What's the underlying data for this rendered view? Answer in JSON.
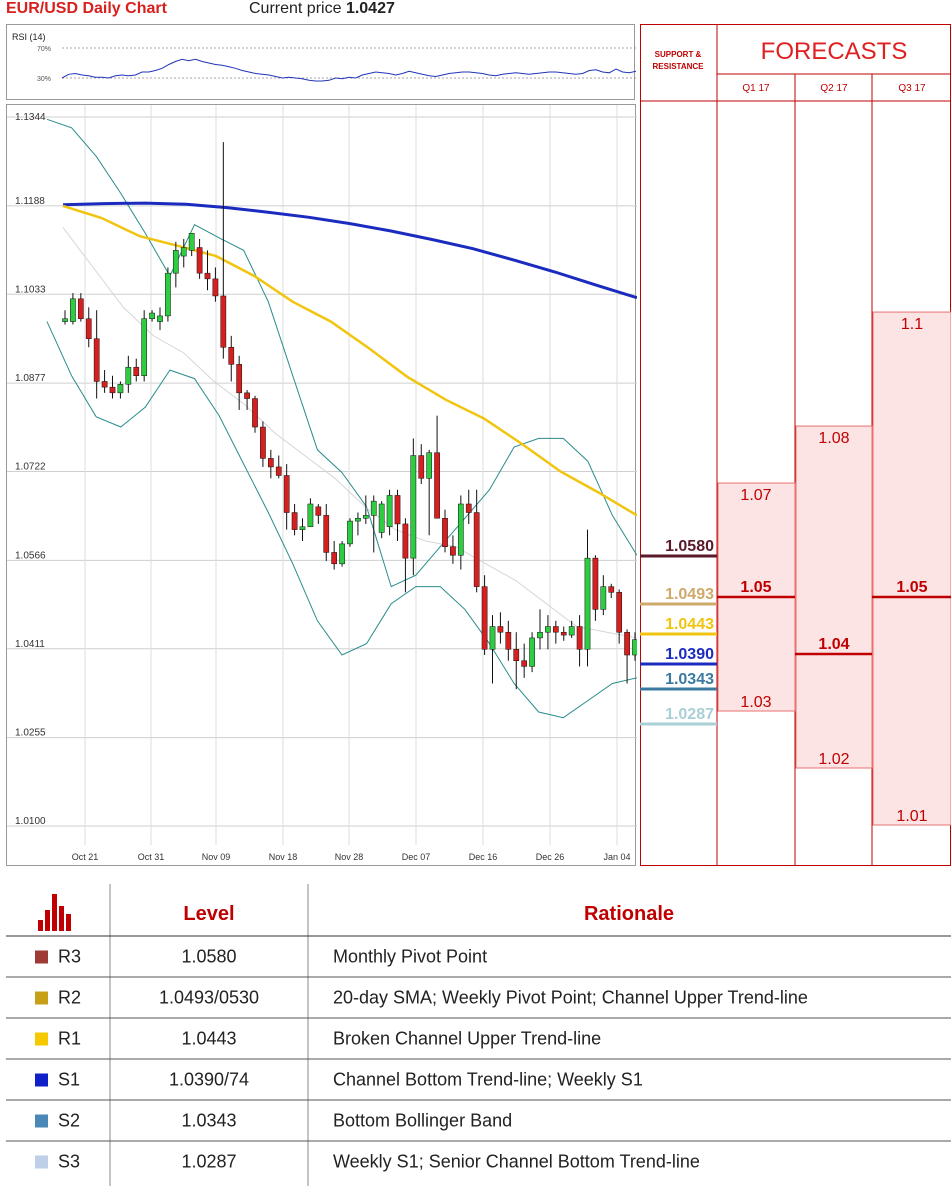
{
  "header": {
    "title": "EUR/USD Daily Chart",
    "price_label": "Current price",
    "price_value": "1.0427"
  },
  "rsi": {
    "label": "RSI (14)",
    "levels": [
      "70%",
      "30%"
    ],
    "values": [
      30,
      35,
      36,
      34,
      33,
      31,
      31,
      30,
      33,
      34,
      33,
      34,
      38,
      38,
      40,
      43,
      48,
      52,
      55,
      53,
      55,
      52,
      50,
      48,
      47,
      45,
      43,
      40,
      38,
      36,
      35,
      34,
      32,
      30,
      31,
      30,
      29,
      27,
      26,
      26,
      27,
      30,
      29,
      31,
      30,
      34,
      36,
      38,
      37,
      36,
      34,
      36,
      39,
      37,
      35,
      33,
      32,
      34,
      36,
      37,
      38,
      38,
      37,
      36,
      34,
      33,
      35,
      36,
      37,
      36,
      35,
      36,
      37,
      38,
      38,
      37,
      36,
      35,
      36,
      40,
      41,
      38,
      37,
      42,
      38,
      37,
      39
    ]
  },
  "chart_data": {
    "type": "candlestick",
    "ylim": [
      1.01,
      1.1344
    ],
    "y_ticks": [
      "1.1344",
      "1.1188",
      "1.1033",
      "1.0877",
      "1.0722",
      "1.0566",
      "1.0411",
      "1.0255",
      "1.0100"
    ],
    "x_ticks": [
      "Oct 21",
      "Oct 31",
      "Nov 09",
      "Nov 18",
      "Nov 28",
      "Dec 07",
      "Dec 16",
      "Dec 26",
      "Jan 04"
    ],
    "candles": [
      [
        1.0985,
        1.1005,
        1.098,
        1.099
      ],
      [
        1.0985,
        1.1035,
        1.098,
        1.1025
      ],
      [
        1.1025,
        1.1035,
        1.0985,
        1.099
      ],
      [
        1.099,
        1.101,
        1.094,
        1.0955
      ],
      [
        1.0955,
        1.1005,
        1.085,
        1.088
      ],
      [
        1.088,
        1.09,
        1.086,
        1.087
      ],
      [
        1.087,
        1.089,
        1.085,
        1.086
      ],
      [
        1.086,
        1.088,
        1.085,
        1.0875
      ],
      [
        1.0875,
        1.0925,
        1.086,
        1.0905
      ],
      [
        1.0905,
        1.092,
        1.088,
        1.089
      ],
      [
        1.089,
        1.1005,
        1.088,
        1.099
      ],
      [
        1.099,
        1.1005,
        1.0985,
        1.1
      ],
      [
        1.0985,
        1.101,
        1.097,
        1.0995
      ],
      [
        1.0995,
        1.108,
        1.0985,
        1.107
      ],
      [
        1.107,
        1.1125,
        1.1045,
        1.111
      ],
      [
        1.11,
        1.113,
        1.108,
        1.1115
      ],
      [
        1.111,
        1.114,
        1.11,
        1.114
      ],
      [
        1.1115,
        1.113,
        1.106,
        1.107
      ],
      [
        1.107,
        1.111,
        1.104,
        1.106
      ],
      [
        1.106,
        1.108,
        1.102,
        1.103
      ],
      [
        1.103,
        1.13,
        1.092,
        1.094
      ],
      [
        1.094,
        1.096,
        1.088,
        1.091
      ],
      [
        1.091,
        1.0925,
        1.083,
        1.086
      ],
      [
        1.086,
        1.0865,
        1.083,
        1.085
      ],
      [
        1.085,
        1.0855,
        1.079,
        1.08
      ],
      [
        1.08,
        1.081,
        1.073,
        1.0745
      ],
      [
        1.0745,
        1.076,
        1.071,
        1.073
      ],
      [
        1.073,
        1.075,
        1.071,
        1.0715
      ],
      [
        1.0715,
        1.0735,
        1.062,
        1.065
      ],
      [
        1.065,
        1.0665,
        1.061,
        1.062
      ],
      [
        1.062,
        1.064,
        1.06,
        1.0625
      ],
      [
        1.0625,
        1.0675,
        1.0625,
        1.0665
      ],
      [
        1.066,
        1.0665,
        1.063,
        1.0645
      ],
      [
        1.0645,
        1.0665,
        1.0565,
        1.058
      ],
      [
        1.058,
        1.06,
        1.055,
        1.056
      ],
      [
        1.056,
        1.06,
        1.0555,
        1.0595
      ],
      [
        1.0595,
        1.064,
        1.059,
        1.0635
      ],
      [
        1.0635,
        1.065,
        1.061,
        1.064
      ],
      [
        1.064,
        1.068,
        1.063,
        1.0645
      ],
      [
        1.0645,
        1.068,
        1.058,
        1.067
      ],
      [
        1.0615,
        1.067,
        1.0605,
        1.0665
      ],
      [
        1.0625,
        1.069,
        1.061,
        1.068
      ],
      [
        1.068,
        1.069,
        1.06,
        1.063
      ],
      [
        1.063,
        1.064,
        1.051,
        1.057
      ],
      [
        1.057,
        1.078,
        1.054,
        1.075
      ],
      [
        1.075,
        1.077,
        1.07,
        1.071
      ],
      [
        1.071,
        1.076,
        1.061,
        1.0755
      ],
      [
        1.0755,
        1.082,
        1.069,
        1.064
      ],
      [
        1.064,
        1.0655,
        1.058,
        1.059
      ],
      [
        1.059,
        1.061,
        1.056,
        1.0575
      ],
      [
        1.0575,
        1.068,
        1.055,
        1.0665
      ],
      [
        1.0665,
        1.069,
        1.063,
        1.065
      ],
      [
        1.065,
        1.069,
        1.051,
        1.052
      ],
      [
        1.052,
        1.054,
        1.04,
        1.041
      ],
      [
        1.041,
        1.047,
        1.035,
        1.045
      ],
      [
        1.045,
        1.0475,
        1.042,
        1.044
      ],
      [
        1.044,
        1.046,
        1.039,
        1.041
      ],
      [
        1.041,
        1.044,
        1.034,
        1.039
      ],
      [
        1.039,
        1.042,
        1.036,
        1.038
      ],
      [
        1.038,
        1.044,
        1.037,
        1.043
      ],
      [
        1.043,
        1.048,
        1.041,
        1.044
      ],
      [
        1.044,
        1.047,
        1.041,
        1.045
      ],
      [
        1.045,
        1.046,
        1.042,
        1.044
      ],
      [
        1.044,
        1.045,
        1.0425,
        1.0435
      ],
      [
        1.0435,
        1.046,
        1.043,
        1.045
      ],
      [
        1.045,
        1.047,
        1.038,
        1.041
      ],
      [
        1.041,
        1.062,
        1.038,
        1.057
      ],
      [
        1.057,
        1.0575,
        1.046,
        1.048
      ],
      [
        1.048,
        1.054,
        1.047,
        1.052
      ],
      [
        1.052,
        1.0525,
        1.05,
        1.051
      ],
      [
        1.051,
        1.0515,
        1.042,
        1.044
      ],
      [
        1.044,
        1.0445,
        1.035,
        1.04
      ],
      [
        1.04,
        1.044,
        1.039,
        1.0427
      ]
    ],
    "series": [
      {
        "name": "",
        "color": "#1c2bbf",
        "values": [
          1.119,
          1.1192,
          1.1193,
          1.1191,
          1.1185,
          1.1177,
          1.1168,
          1.1157,
          1.1144,
          1.1129,
          1.1113,
          1.1093,
          1.1072,
          1.1049,
          1.1027
        ]
      },
      {
        "name": "",
        "color": "#f1c40f",
        "values": [
          1.1188,
          1.1167,
          1.1135,
          1.1118,
          1.11,
          1.1065,
          1.102,
          1.0985,
          1.0938,
          1.0888,
          1.0848,
          1.0815,
          1.077,
          1.0722,
          1.0685,
          1.0645
        ]
      },
      {
        "name": "",
        "color": "#2a8c8c",
        "values": [
          1.134,
          1.1325,
          1.1275,
          1.121,
          1.114,
          1.1065,
          1.1155,
          1.1132,
          1.111,
          1.102,
          1.089,
          1.076,
          1.072,
          1.066,
          1.052,
          1.054,
          1.059,
          1.064,
          1.069,
          1.0765,
          1.078,
          1.078,
          1.074,
          1.0645,
          1.0575
        ]
      },
      {
        "name": "",
        "color": "#2a8c8c",
        "values": [
          1.0985,
          1.089,
          1.0818,
          1.08,
          1.0835,
          1.09,
          1.0885,
          1.082,
          1.0735,
          1.065,
          1.056,
          1.046,
          1.04,
          1.042,
          1.049,
          1.052,
          1.052,
          1.048,
          1.042,
          1.035,
          1.03,
          1.029,
          1.032,
          1.035,
          1.036
        ]
      },
      {
        "name": "",
        "color": "#d6d6d6",
        "values": [
          1.115,
          1.108,
          1.101,
          1.096,
          1.093,
          1.088,
          1.084,
          1.079,
          1.075,
          1.071,
          1.066,
          1.062,
          1.06,
          1.059,
          1.056,
          1.053,
          1.049,
          1.045,
          1.044,
          1.043
        ]
      }
    ],
    "levels": [
      {
        "value": "1.0580",
        "color": "#5b1a2a"
      },
      {
        "value": "1.0493",
        "color": "#cfa96a"
      },
      {
        "value": "1.0443",
        "color": "#f1c40f"
      },
      {
        "value": "1.0390",
        "color": "#1c2bbf"
      },
      {
        "value": "1.0343",
        "color": "#3b7aa0"
      },
      {
        "value": "1.0287",
        "color": "#a8d0d6"
      }
    ],
    "forecast": {
      "support_label": "SUPPORT & RESISTANCE",
      "title": "FORECASTS",
      "columns": [
        {
          "label": "Q1 17",
          "high": "1.07",
          "mid": "1.05",
          "low": "1.03"
        },
        {
          "label": "Q2 17",
          "high": "1.08",
          "mid": "1.04",
          "low": "1.02"
        },
        {
          "label": "Q3 17",
          "high": "1.1",
          "mid": "1.05",
          "low": "1.01"
        }
      ]
    }
  },
  "table": {
    "headers": [
      "Level",
      "Rationale"
    ],
    "rows": [
      {
        "tag": "R3",
        "color": "#9e3b36",
        "level": "1.0580",
        "rationale": "Monthly Pivot Point"
      },
      {
        "tag": "R2",
        "color": "#c8a018",
        "level": "1.0493/0530",
        "rationale": "20-day SMA; Weekly Pivot Point; Channel Upper Trend-line"
      },
      {
        "tag": "R1",
        "color": "#f6c800",
        "level": "1.0443",
        "rationale": "Broken Channel Upper Trend-line"
      },
      {
        "tag": "S1",
        "color": "#1020c8",
        "level": "1.0390/74",
        "rationale": "Channel Bottom Trend-line; Weekly S1"
      },
      {
        "tag": "S2",
        "color": "#4a88b8",
        "level": "1.0343",
        "rationale": "Bottom Bollinger Band"
      },
      {
        "tag": "S3",
        "color": "#bdd0e8",
        "level": "1.0287",
        "rationale": "Weekly S1; Senior Channel Bottom Trend-line"
      }
    ]
  }
}
